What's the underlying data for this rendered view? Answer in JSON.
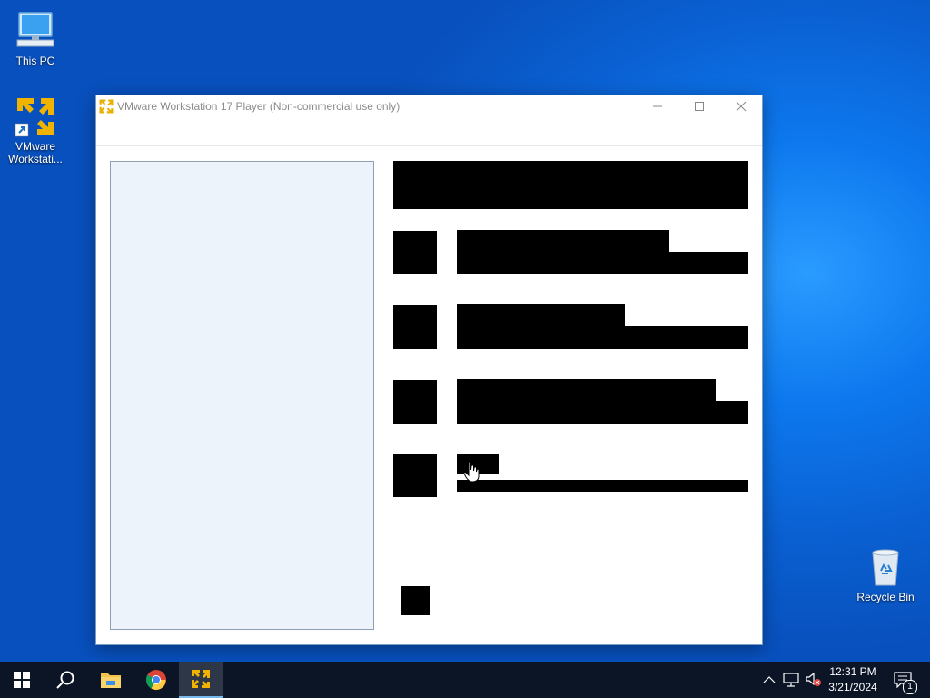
{
  "desktop": {
    "icons": [
      {
        "label": "This PC",
        "icon": "monitor-icon"
      },
      {
        "label": "VMware Workstati...",
        "icon": "vmware-icon"
      },
      {
        "label": "Recycle Bin",
        "icon": "recycle-bin-icon"
      }
    ]
  },
  "window": {
    "title": "VMware Workstation 17 Player (Non-commercial use only)",
    "controls": {
      "minimize": "minimize-icon",
      "maximize": "maximize-icon",
      "close": "close-icon"
    }
  },
  "taskbar": {
    "apps": [
      {
        "name": "Start",
        "icon": "windows-start-icon"
      },
      {
        "name": "Search",
        "icon": "search-icon"
      },
      {
        "name": "File Explorer",
        "icon": "folder-icon"
      },
      {
        "name": "Google Chrome",
        "icon": "chrome-icon"
      },
      {
        "name": "VMware Workstation",
        "icon": "vmware-icon"
      }
    ],
    "clock": {
      "time": "12:31 PM",
      "date": "3/21/2024"
    },
    "notification_count": "1"
  },
  "colors": {
    "desktop_blue": "#0a62d6",
    "vmware_yellow": "#f0b400",
    "taskbar": "#0b1526",
    "library_panel": "#edf3fb"
  }
}
